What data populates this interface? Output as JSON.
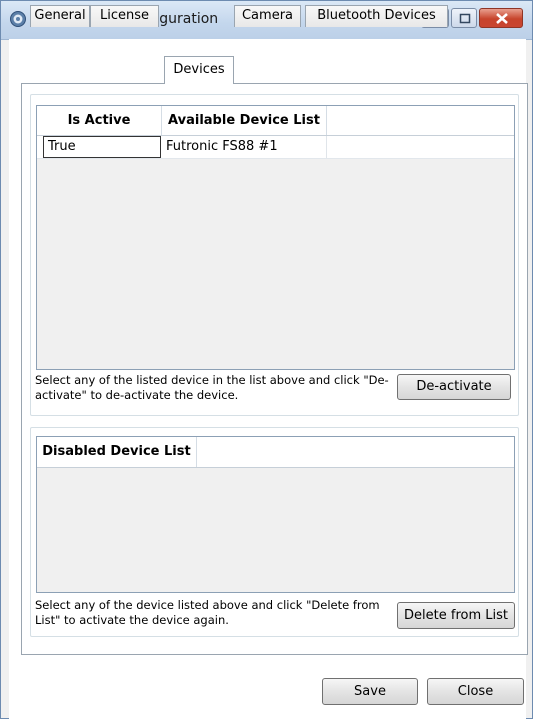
{
  "window": {
    "title": "FbF Listener Configuration",
    "icon": "gear-icon"
  },
  "tabs": [
    {
      "label": "General",
      "active": false
    },
    {
      "label": "License",
      "active": false
    },
    {
      "label": "Devices",
      "active": true
    },
    {
      "label": "Camera",
      "active": false
    },
    {
      "label": "Bluetooth Devices",
      "active": false
    }
  ],
  "available_grid": {
    "columns": [
      "Is Active",
      "Available Device List"
    ],
    "rows": [
      {
        "is_active": "True",
        "device": "Futronic FS88 #1"
      }
    ]
  },
  "available_hint": "Select any of the listed device in the list above and click \"De-activate\" to de-activate the device.",
  "deactivate_label": "De-activate",
  "disabled_grid": {
    "columns": [
      "Disabled Device List"
    ],
    "rows": []
  },
  "disabled_hint": "Select any of the device listed above and click \"Delete from List\" to activate the device again.",
  "delete_label": "Delete from List",
  "footer": {
    "save_label": "Save",
    "close_label": "Close"
  },
  "colors": {
    "titlebar": "#c3d6ec",
    "close_button": "#c7442c"
  }
}
